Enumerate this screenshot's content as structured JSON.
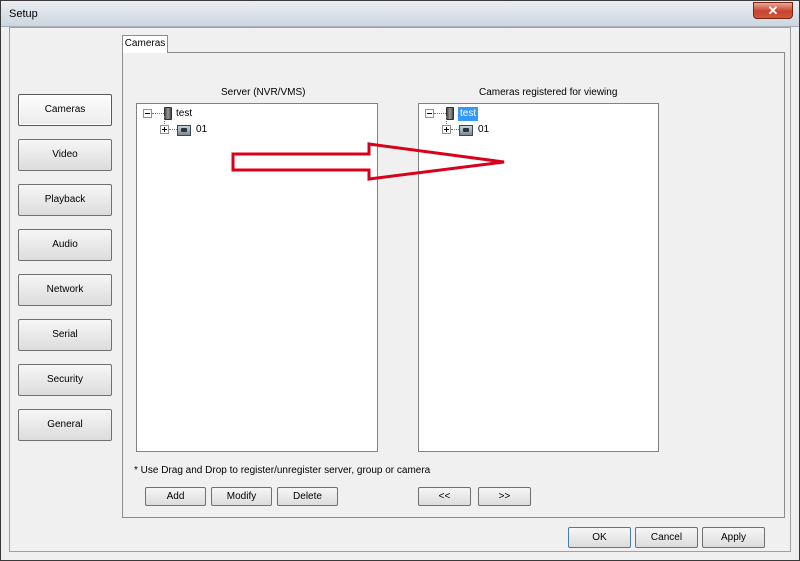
{
  "window": {
    "title": "Setup",
    "close_glyph": "✕"
  },
  "nav": {
    "items": [
      {
        "label": "Cameras",
        "active": true
      },
      {
        "label": "Video"
      },
      {
        "label": "Playback"
      },
      {
        "label": "Audio"
      },
      {
        "label": "Network"
      },
      {
        "label": "Serial"
      },
      {
        "label": "Security"
      },
      {
        "label": "General"
      }
    ]
  },
  "tab": {
    "label": "Cameras"
  },
  "server_panel": {
    "title": "Server (NVR/VMS)",
    "tree": {
      "root": "test",
      "child": "01"
    }
  },
  "registered_panel": {
    "title": "Cameras registered for viewing",
    "tree": {
      "root": "test",
      "child": "01"
    }
  },
  "hint": "* Use Drag and Drop to register/unregister server, group or camera",
  "buttons": {
    "add": "Add",
    "modify": "Modify",
    "delete": "Delete",
    "move_left": "<<",
    "move_right": ">>",
    "ok": "OK",
    "cancel": "Cancel",
    "apply": "Apply"
  },
  "colors": {
    "selection": "#3399ff",
    "annotation_arrow": "#d9001b"
  }
}
